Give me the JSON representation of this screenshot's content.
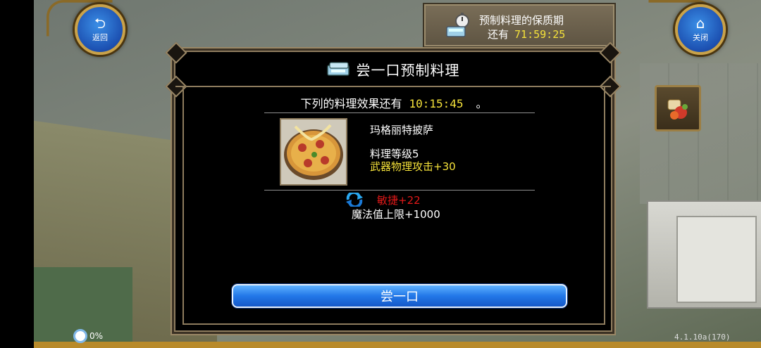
{
  "top_left": {
    "back_label": "返回",
    "back_icon": "back-arrow-icon"
  },
  "top_right": {
    "close_label": "关闭",
    "close_icon": "home-icon"
  },
  "expiry": {
    "title": "预制料理的保质期",
    "prefix": "还有",
    "time": "71:59:25"
  },
  "panel": {
    "title": "尝一口预制料理",
    "remaining_prefix": "下列的料理效果还有",
    "remaining_time": "10:15:45",
    "remaining_suffix": "。",
    "food": {
      "name": "玛格丽特披萨",
      "level": "料理等级5",
      "effect": "武器物理攻击+30"
    },
    "bonus_red": "敏捷+22",
    "bonus_white": "魔法值上限+1000",
    "taste_button": "尝一口"
  },
  "status": {
    "battery": "0%",
    "version": "4.1.10a(170)"
  },
  "colors": {
    "accent_yellow": "#f5e23a",
    "bonus_red": "#e01818",
    "button_blue": "#2277e8",
    "frame": "#8e7c5e"
  }
}
